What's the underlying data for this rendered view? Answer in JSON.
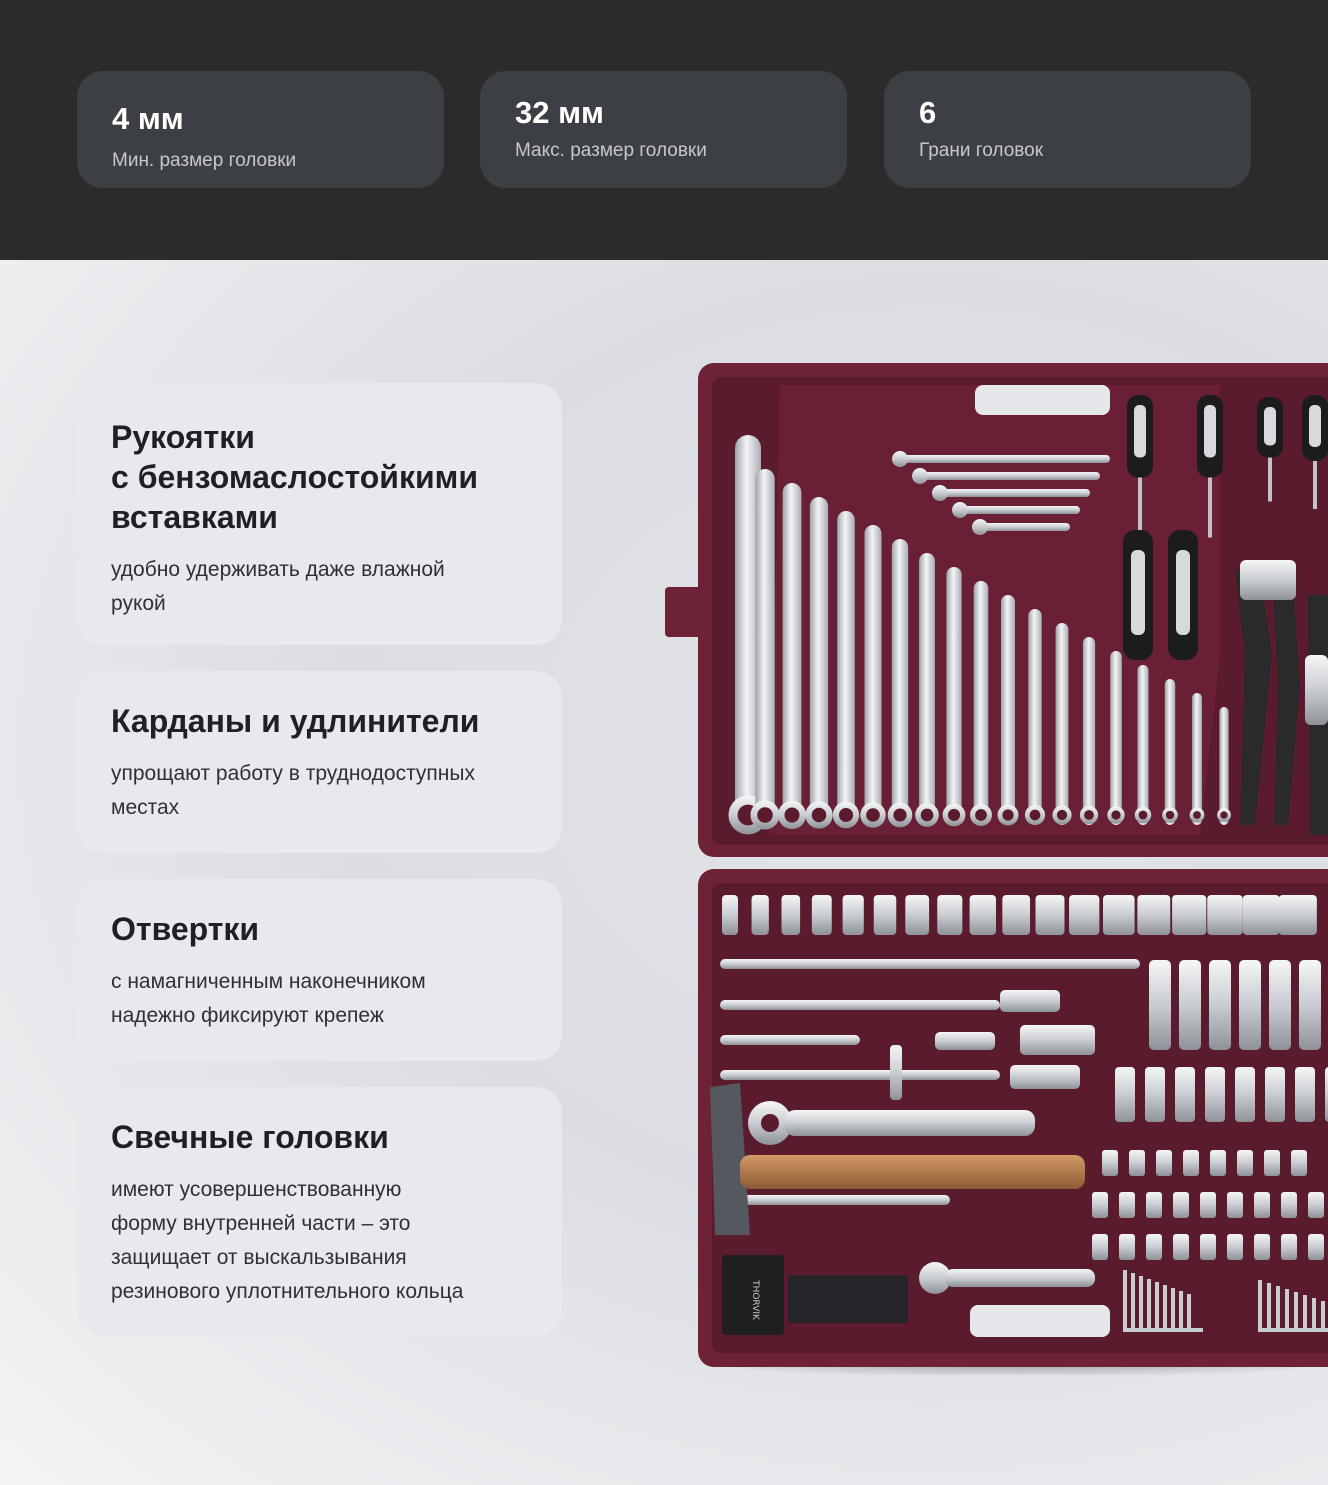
{
  "stats": [
    {
      "value": "4 мм",
      "label": "Мин. размер головки"
    },
    {
      "value": "32 мм",
      "label": "Макс. размер головки"
    },
    {
      "value": "6",
      "label": "Грани головок"
    }
  ],
  "features": [
    {
      "title": "Рукоятки\nс бензомаслостойкими\nвставками",
      "description": "удобно удерживать даже влажной\nрукой"
    },
    {
      "title": "Карданы и удлинители",
      "description": "упрощают работу в труднодоступных\nместах"
    },
    {
      "title": "Отвертки",
      "description": "с намагниченным наконечником\nнадежно фиксируют крепеж"
    },
    {
      "title": "Свечные головки",
      "description": "имеют усовершенствованную\nформу внутренней части – это\nзащищает от выскальзывания\nрезинового уплотнительного кольца"
    }
  ],
  "brand_mark": "THORVIK",
  "colors": {
    "header_bg": "#2c2b2b",
    "card_dark": "#3c3f44",
    "card_light": "#e8e9ed",
    "case": "#6e2236",
    "case_dark": "#561a2b",
    "chrome": "#d6d8dc",
    "wood": "#b07a4e"
  }
}
